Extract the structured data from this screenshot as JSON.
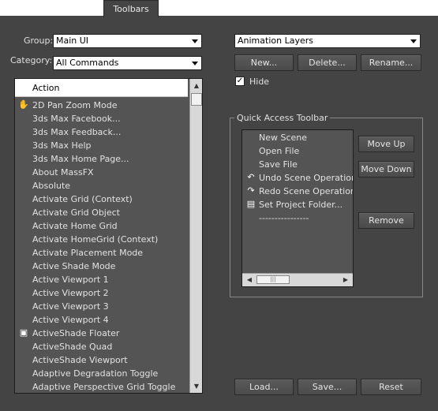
{
  "tabs": [
    {
      "label": "Toolbars"
    }
  ],
  "left": {
    "group_label": "Group:",
    "group_value": "Main UI",
    "category_label": "Category:",
    "category_value": "All Commands",
    "list_header": "Action",
    "actions": [
      {
        "label": "2D Pan Zoom Mode",
        "icon": "hand-icon"
      },
      {
        "label": "3ds Max Facebook...",
        "icon": ""
      },
      {
        "label": "3ds Max Feedback...",
        "icon": ""
      },
      {
        "label": "3ds Max Help",
        "icon": ""
      },
      {
        "label": "3ds Max Home Page...",
        "icon": ""
      },
      {
        "label": "About MassFX",
        "icon": ""
      },
      {
        "label": "Absolute",
        "icon": ""
      },
      {
        "label": "Activate Grid (Context)",
        "icon": ""
      },
      {
        "label": "Activate Grid Object",
        "icon": ""
      },
      {
        "label": "Activate Home Grid",
        "icon": ""
      },
      {
        "label": "Activate HomeGrid (Context)",
        "icon": ""
      },
      {
        "label": "Activate Placement Mode",
        "icon": ""
      },
      {
        "label": "Active Shade Mode",
        "icon": ""
      },
      {
        "label": "Active Viewport 1",
        "icon": ""
      },
      {
        "label": "Active Viewport 2",
        "icon": ""
      },
      {
        "label": "Active Viewport 3",
        "icon": ""
      },
      {
        "label": "Active Viewport 4",
        "icon": ""
      },
      {
        "label": "ActiveShade Floater",
        "icon": "activeshade-icon"
      },
      {
        "label": "ActiveShade Quad",
        "icon": ""
      },
      {
        "label": "ActiveShade Viewport",
        "icon": ""
      },
      {
        "label": "Adaptive Degradation Toggle",
        "icon": ""
      },
      {
        "label": "Adaptive Perspective Grid Toggle",
        "icon": ""
      }
    ],
    "load_label": "Load...",
    "save_label": "Save...",
    "reset_label": "Reset"
  },
  "right": {
    "toolbar_value": "Animation Layers",
    "new_label": "New...",
    "delete_label": "Delete...",
    "rename_label": "Rename...",
    "hide_label": "Hide",
    "hide_checked": "✓",
    "quick_access_title": "Quick Access Toolbar",
    "quick_items": [
      {
        "label": "New Scene",
        "icon": ""
      },
      {
        "label": "Open File",
        "icon": ""
      },
      {
        "label": "Save File",
        "icon": ""
      },
      {
        "label": "Undo Scene Operation",
        "icon": "undo-arrow-icon"
      },
      {
        "label": "Redo Scene Operation",
        "icon": "redo-arrow-icon"
      },
      {
        "label": "Set Project Folder...",
        "icon": "project-folder-icon"
      },
      {
        "label": "----------------",
        "icon": ""
      }
    ],
    "move_up_label": "Move Up",
    "move_down_label": "Move Down",
    "remove_label": "Remove"
  }
}
